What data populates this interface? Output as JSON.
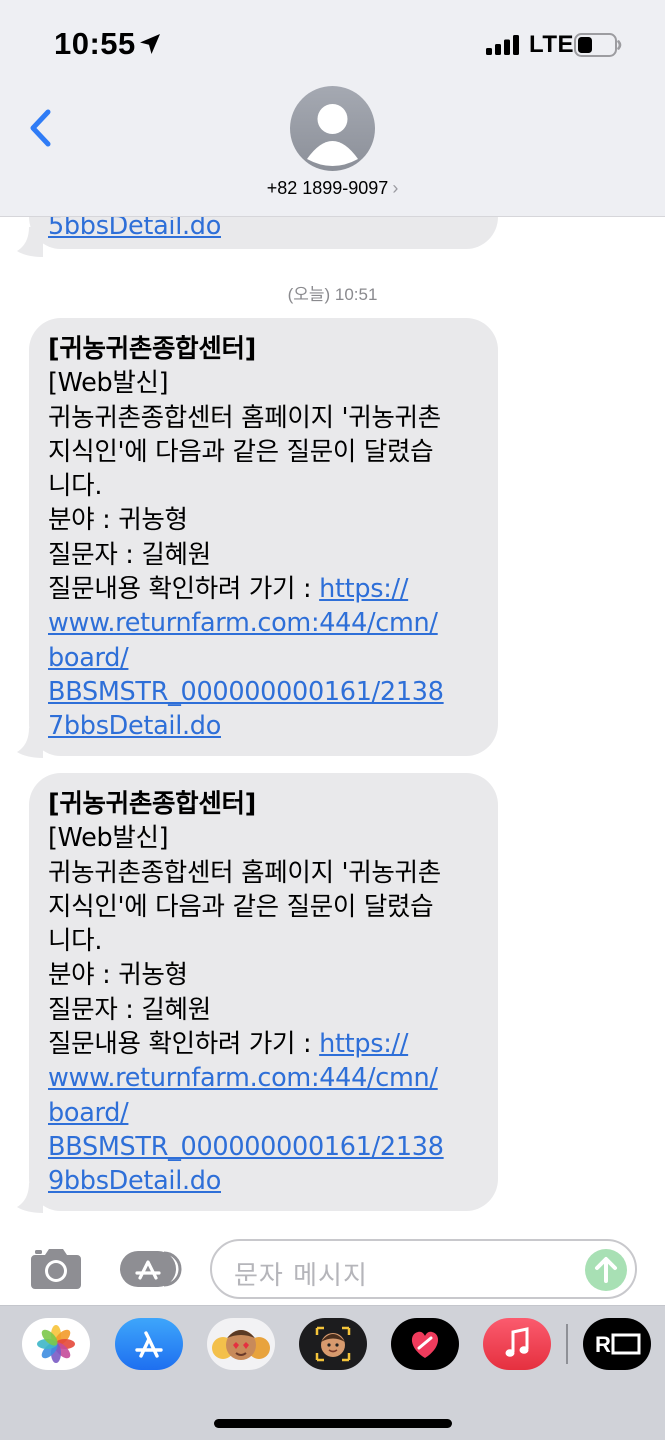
{
  "status_bar": {
    "time": "10:55",
    "network": "LTE"
  },
  "header": {
    "contact_number": "+82 1899-9097",
    "contact_chevron": "›"
  },
  "conversation": {
    "previous_link_tail": "5bbsDetail.do",
    "timestamp": "(오늘) 10:51",
    "messages": [
      {
        "title": "[귀농귀촌종합센터]",
        "line2": "[Web발신]",
        "line3": "귀농귀촌종합센터 홈페이지 '귀농귀촌",
        "line4": "지식인'에 다음과 같은 질문이 달렸습",
        "line5": "니다.",
        "line6": "분야 : 귀농형",
        "line7": "질문자 : 길혜원",
        "link_prefix": "질문내용 확인하려 가기 : ",
        "link_part1": "https://",
        "link_part2": "www.returnfarm.com:444/cmn/",
        "link_part3": "board/",
        "link_part4": "BBSMSTR_000000000161/2138",
        "link_part5": "7bbsDetail.do"
      },
      {
        "title": "[귀농귀촌종합센터]",
        "line2": "[Web발신]",
        "line3": "귀농귀촌종합센터 홈페이지 '귀농귀촌",
        "line4": "지식인'에 다음과 같은 질문이 달렸습",
        "line5": "니다.",
        "line6": "분야 : 귀농형",
        "line7": "질문자 : 길혜원",
        "link_prefix": "질문내용 확인하려 가기 : ",
        "link_part1": "https://",
        "link_part2": "www.returnfarm.com:444/cmn/",
        "link_part3": "board/",
        "link_part4": "BBSMSTR_000000000161/2138",
        "link_part5": "9bbsDetail.do"
      }
    ]
  },
  "input_bar": {
    "placeholder": "문자 메시지"
  },
  "app_drawer": {
    "apps": [
      "photos-app-icon",
      "app-store-icon",
      "memoji-stickers-icon",
      "memoji-icon",
      "heart-app-icon",
      "music-app-icon",
      "r-app-icon"
    ],
    "r_app_label": "R"
  },
  "colors": {
    "header_bg": "#eeeff3",
    "bubble_bg": "#e9e9eb",
    "link": "#2e6fd8",
    "ios_blue": "#2f7cf6",
    "send_button": "#a8e0b4"
  }
}
